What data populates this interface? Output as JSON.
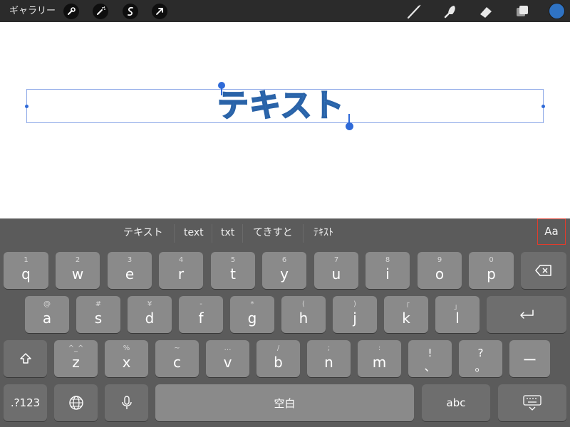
{
  "topbar": {
    "gallery_label": "ギャラリー",
    "left_tools": [
      "wrench-icon",
      "magic-wand-icon",
      "selection-s-icon",
      "transform-arrow-icon"
    ],
    "right_tools": [
      "brush-icon",
      "smudge-icon",
      "eraser-icon",
      "layers-icon"
    ],
    "current_color": "#2f73c4"
  },
  "canvas": {
    "text": "テキスト",
    "text_color": "#3b86cc"
  },
  "keyboard": {
    "suggestions": [
      "テキスト",
      "text",
      "txt",
      "てきすと",
      "ﾃｷｽﾄ"
    ],
    "aa_label": "Aa",
    "row1": [
      {
        "sub": "1",
        "main": "q"
      },
      {
        "sub": "2",
        "main": "w"
      },
      {
        "sub": "3",
        "main": "e"
      },
      {
        "sub": "4",
        "main": "r"
      },
      {
        "sub": "5",
        "main": "t"
      },
      {
        "sub": "6",
        "main": "y"
      },
      {
        "sub": "7",
        "main": "u"
      },
      {
        "sub": "8",
        "main": "i"
      },
      {
        "sub": "9",
        "main": "o"
      },
      {
        "sub": "0",
        "main": "p"
      }
    ],
    "row2": [
      {
        "sub": "@",
        "main": "a"
      },
      {
        "sub": "#",
        "main": "s"
      },
      {
        "sub": "¥",
        "main": "d"
      },
      {
        "sub": "-",
        "main": "f"
      },
      {
        "sub": "*",
        "main": "g"
      },
      {
        "sub": "(",
        "main": "h"
      },
      {
        "sub": ")",
        "main": "j"
      },
      {
        "sub": "「",
        "main": "k"
      },
      {
        "sub": "」",
        "main": "l"
      }
    ],
    "row3": [
      {
        "sub": "^_^",
        "main": "z"
      },
      {
        "sub": "%",
        "main": "x"
      },
      {
        "sub": "~",
        "main": "c"
      },
      {
        "sub": "…",
        "main": "v"
      },
      {
        "sub": "/",
        "main": "b"
      },
      {
        "sub": ";",
        "main": "n"
      },
      {
        "sub": ":",
        "main": "m"
      },
      {
        "sub": "!",
        "main": "、"
      },
      {
        "sub": "?",
        "main": "。"
      }
    ],
    "minus_label": "ー",
    "num_label": ".?123",
    "space_label": "空白",
    "abc_label": "abc"
  }
}
